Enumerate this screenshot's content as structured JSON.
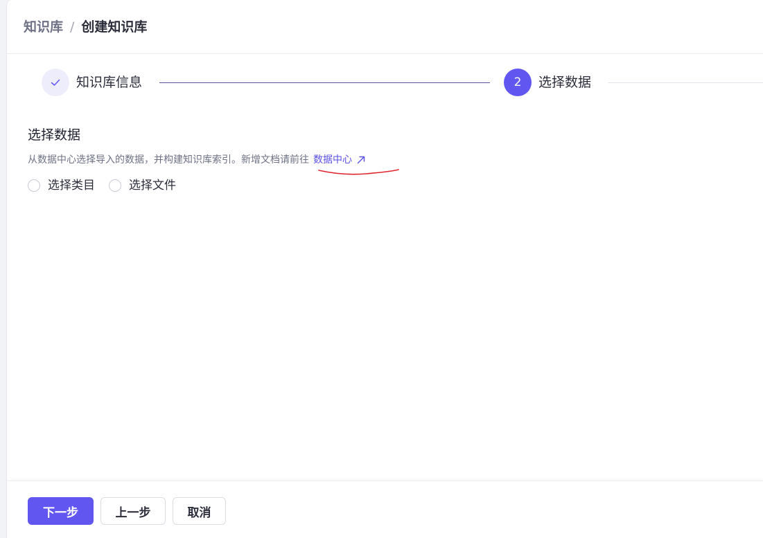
{
  "breadcrumb": {
    "root": "知识库",
    "separator": "/",
    "current": "创建知识库"
  },
  "steps": {
    "step1": {
      "label": "知识库信息",
      "status": "completed",
      "icon": "check-icon"
    },
    "step2": {
      "number": "2",
      "label": "选择数据",
      "status": "active"
    }
  },
  "section": {
    "title": "选择数据",
    "description": "从数据中心选择导入的数据，并构建知识库索引。新增文档请前往",
    "link_label": "数据中心",
    "link_icon": "external-arrow-icon"
  },
  "radio_options": [
    {
      "label": "选择类目",
      "selected": false
    },
    {
      "label": "选择文件",
      "selected": false
    }
  ],
  "footer": {
    "next_label": "下一步",
    "prev_label": "上一步",
    "cancel_label": "取消"
  },
  "colors": {
    "accent": "#6157f0",
    "link": "#5a50e6",
    "annotation": "#e0242b"
  }
}
